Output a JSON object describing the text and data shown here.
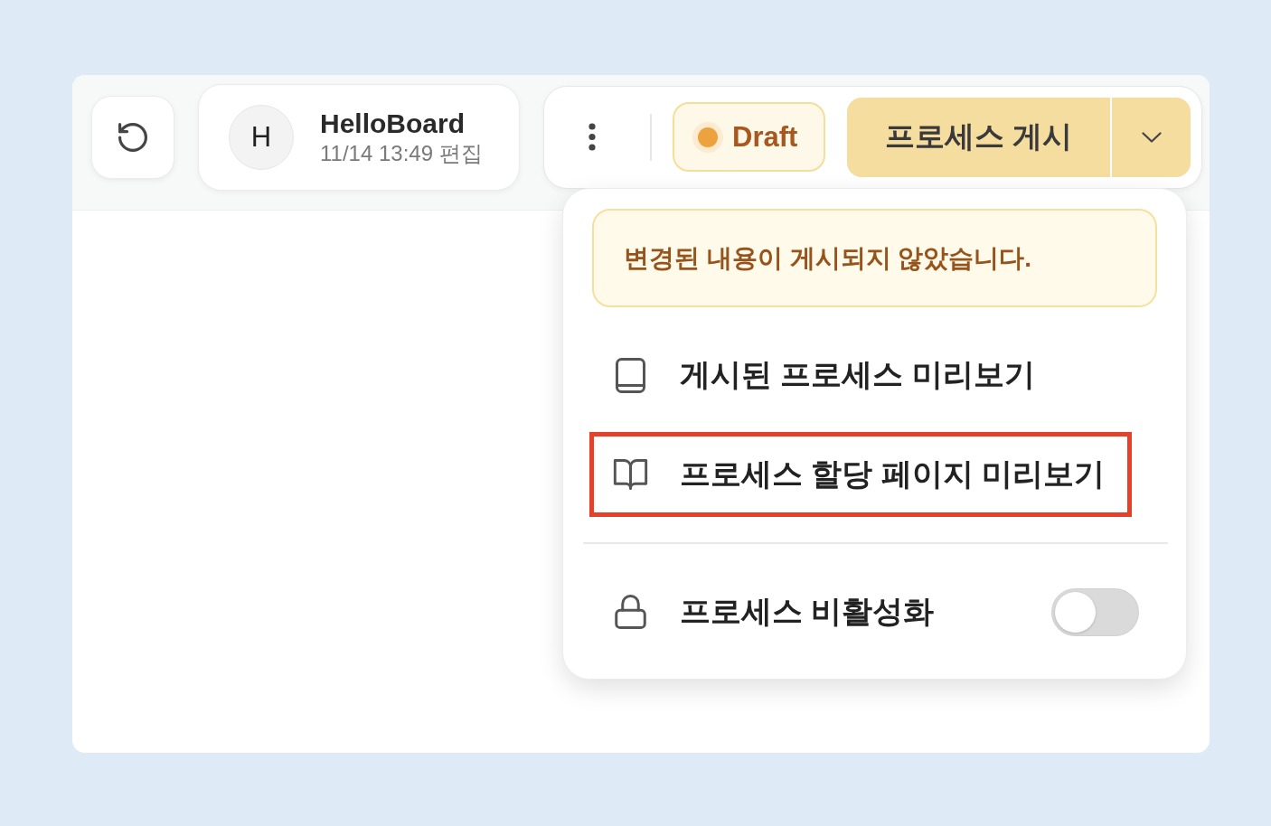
{
  "toolbar": {
    "document": {
      "avatar_initial": "H",
      "title": "HelloBoard",
      "edited": "11/14 13:49 편집"
    },
    "status": {
      "label": "Draft"
    },
    "publish": {
      "label": "프로세스 게시",
      "expanded": true
    }
  },
  "menu": {
    "notice": "변경된 내용이 게시되지 않았습니다.",
    "groups": [
      {
        "items": [
          {
            "kind": "link",
            "label": "게시된 프로세스 미리보기",
            "highlighted": false
          },
          {
            "kind": "link",
            "label": "프로세스 할당 페이지 미리보기",
            "highlighted": true
          }
        ]
      },
      {
        "items": [
          {
            "kind": "toggle",
            "label": "프로세스 비활성화",
            "on": false
          }
        ]
      }
    ]
  }
}
